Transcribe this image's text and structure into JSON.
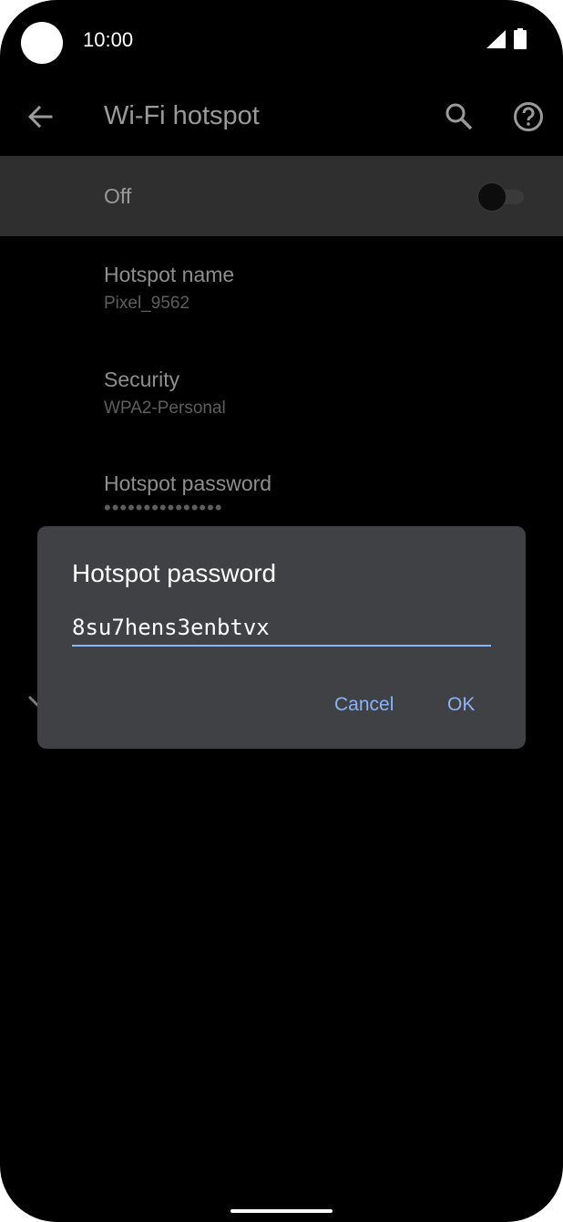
{
  "status_bar": {
    "time": "10:00"
  },
  "app_bar": {
    "title": "Wi-Fi hotspot"
  },
  "switch_row": {
    "label": "Off",
    "enabled": false
  },
  "settings": [
    {
      "title": "Hotspot name",
      "value": "Pixel_9562"
    },
    {
      "title": "Security",
      "value": "WPA2-Personal"
    },
    {
      "title": "Hotspot password",
      "value": "•••••••••••••••"
    }
  ],
  "dialog": {
    "title": "Hotspot password",
    "input_value": "8su7hens3enbtvx",
    "cancel_label": "Cancel",
    "ok_label": "OK"
  },
  "colors": {
    "accent": "#8ab4f8",
    "dialog_bg": "#404145",
    "switch_row_bg": "#2f2f2f"
  }
}
